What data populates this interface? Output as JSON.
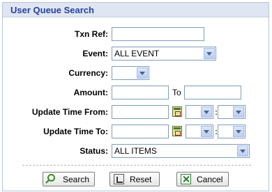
{
  "panel": {
    "title": "User Queue Search"
  },
  "form": {
    "txn_ref": {
      "label": "Txn Ref:",
      "value": ""
    },
    "event": {
      "label": "Event:",
      "selected": "ALL EVENT"
    },
    "currency": {
      "label": "Currency:",
      "selected": ""
    },
    "amount": {
      "label": "Amount:",
      "from": "",
      "to_label": "To",
      "to": ""
    },
    "update_from": {
      "label": "Update Time From:",
      "date": "",
      "hour": "",
      "minute": "",
      "separator": ":"
    },
    "update_to": {
      "label": "Update Time To:",
      "date": "",
      "hour": "",
      "minute": "",
      "separator": ":"
    },
    "status": {
      "label": "Status:",
      "selected": "ALL ITEMS"
    }
  },
  "buttons": {
    "search": "Search",
    "reset": "Reset",
    "cancel": "Cancel"
  },
  "icons": {
    "calendar": "calendar-icon",
    "search": "search-icon",
    "reset": "reset-icon",
    "cancel": "cancel-icon"
  },
  "colors": {
    "title_bar": "#dfe6f2",
    "title_text": "#2a3f9c",
    "border": "#7f9db9"
  }
}
